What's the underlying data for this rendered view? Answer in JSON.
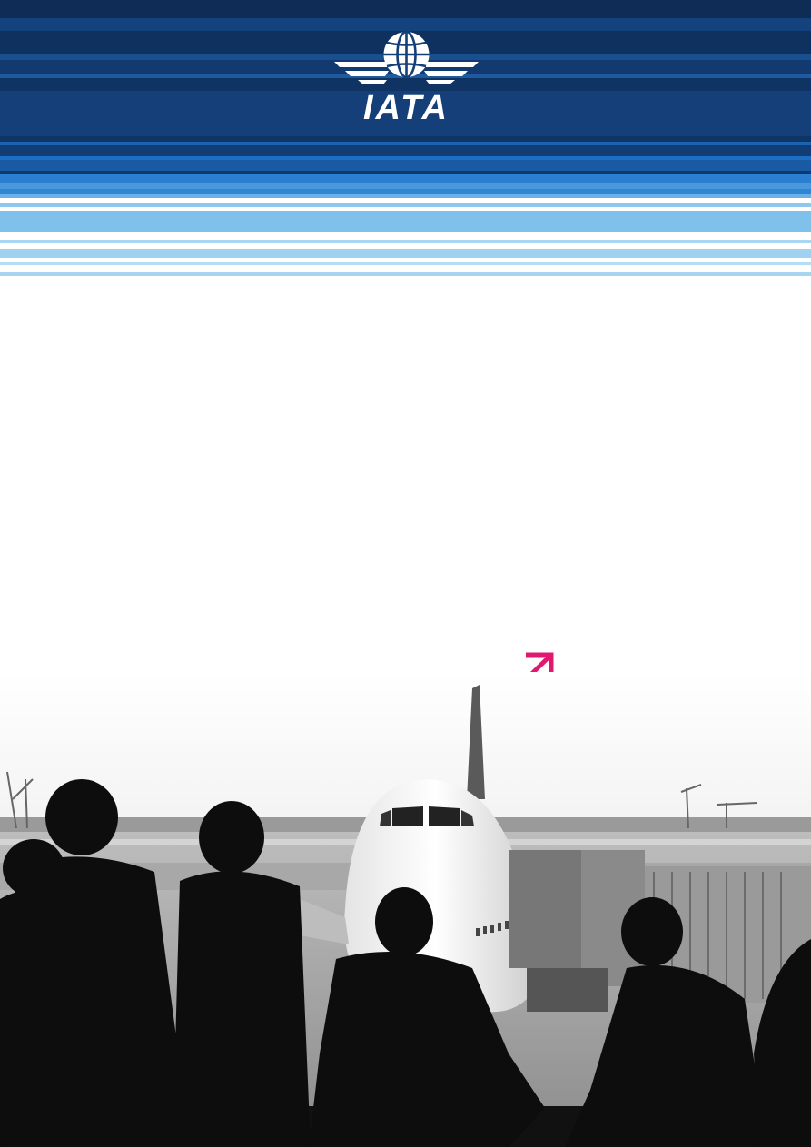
{
  "brand": {
    "logo_text": "IATA",
    "logo_icon": "globe-wings-icon",
    "colors": {
      "navy": "#0f2f5c",
      "blue": "#1a5ea8",
      "sky": "#7fc1ea",
      "accent": "#e0186f"
    }
  },
  "decoration": {
    "arrow_icon": "arrow-up-right-icon"
  },
  "photo": {
    "subject": "airport-terminal-window-photo"
  }
}
